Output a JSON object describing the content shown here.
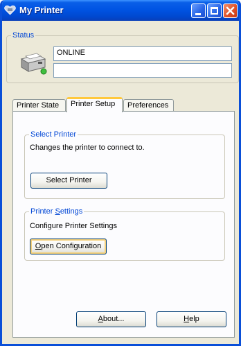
{
  "window": {
    "title": "My Printer",
    "icon": "printer-heart-icon"
  },
  "titlebar_buttons": [
    "minimize",
    "maximize",
    "close"
  ],
  "status": {
    "legend": "Status",
    "line1": "ONLINE",
    "line2": ""
  },
  "tabs": [
    {
      "label": "Printer State",
      "active": false
    },
    {
      "label": "Printer Setup",
      "active": true
    },
    {
      "label": "Preferences",
      "active": false
    }
  ],
  "select_printer": {
    "legend": "Select Printer",
    "description": "Changes the printer to connect to.",
    "button": "Select Printer"
  },
  "printer_settings": {
    "legend_pre": "Printer ",
    "legend_u": "S",
    "legend_post": "ettings",
    "description": "Configure Printer Settings",
    "button_u": "O",
    "button_post": "pen Configuration"
  },
  "footer": {
    "about_u": "A",
    "about_post": "bout...",
    "help_u": "H",
    "help_post": "elp"
  },
  "colors": {
    "titlebar": "#0054e3",
    "dialog": "#ece9d8",
    "legend": "#0046d5",
    "close_button": "#e0522a"
  }
}
